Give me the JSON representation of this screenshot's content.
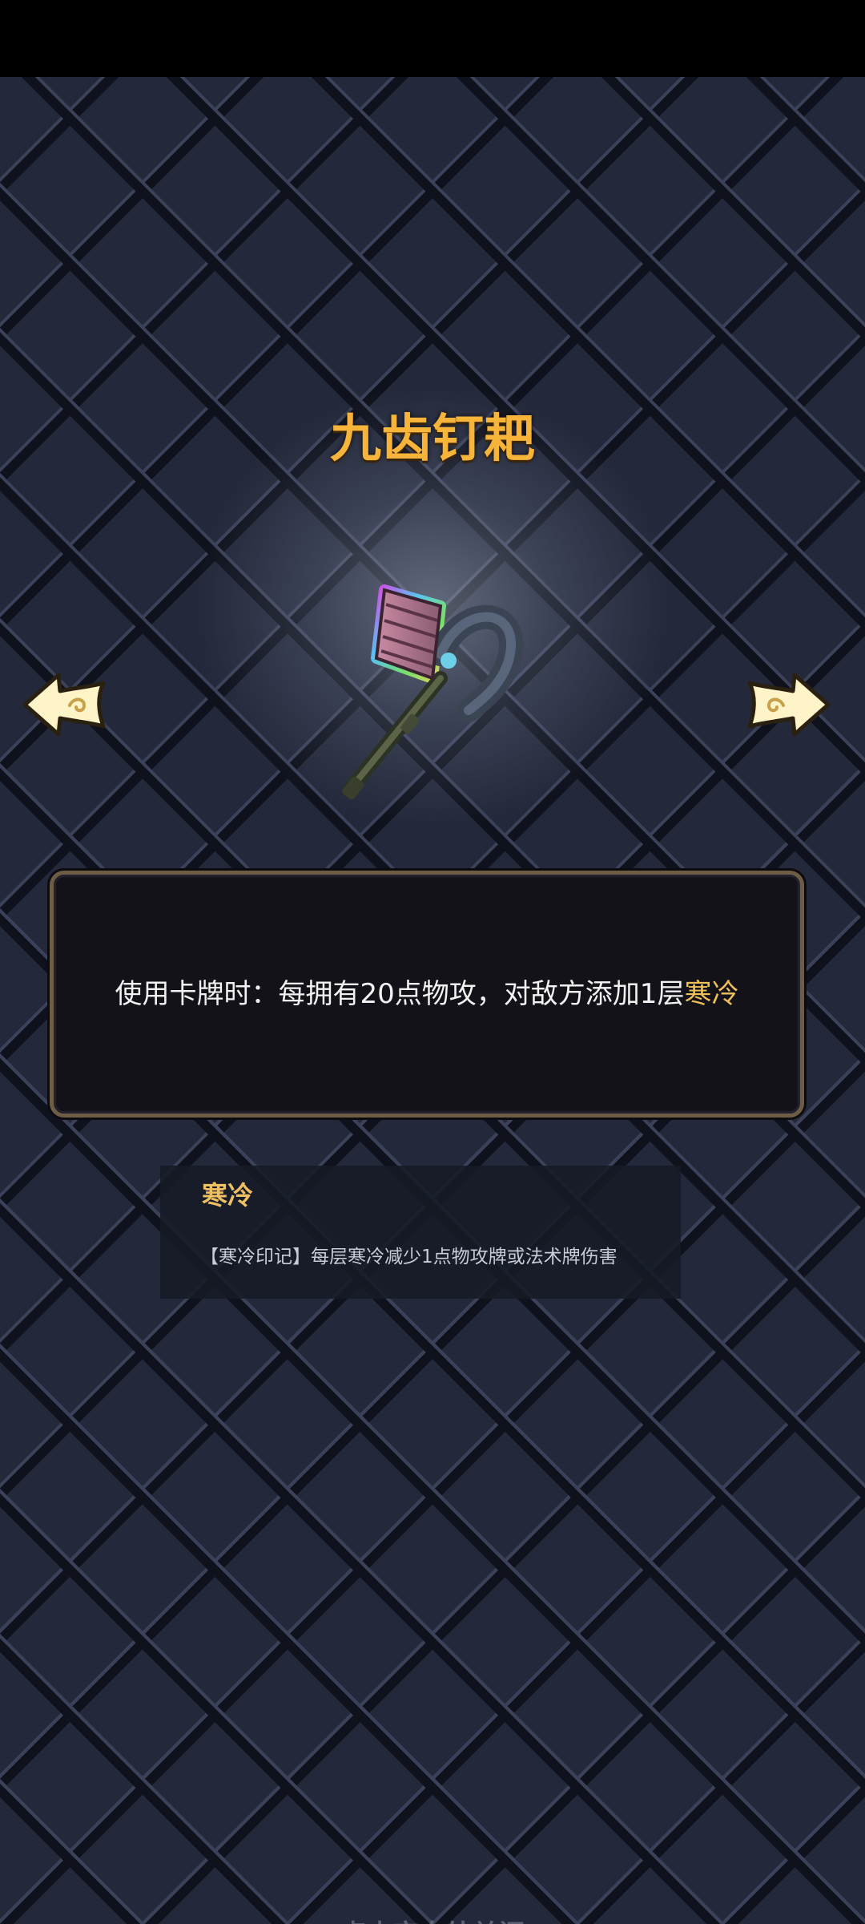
{
  "item": {
    "name": "九齿钉耙",
    "image_icon": "rake-weapon-icon"
  },
  "navigation": {
    "prev_icon": "arrow-left-icon",
    "next_icon": "arrow-right-icon"
  },
  "description": {
    "text": "使用卡牌时：每拥有20点物攻，对敌方添加1层",
    "keyword": "寒冷"
  },
  "keyword_info": {
    "title": "寒冷",
    "description": "【寒冷印记】每层寒冷减少1点物攻牌或法术牌伤害"
  },
  "footer": {
    "close_hint": "点击空白处关闭"
  },
  "colors": {
    "title": "#f6b43a",
    "keyword": "#f1c159",
    "background": "#23283a",
    "panel_border": "#6d5d45"
  }
}
